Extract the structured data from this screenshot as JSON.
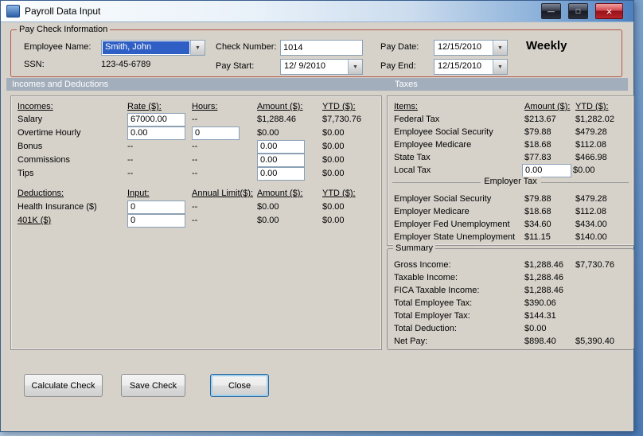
{
  "icons": {
    "minimize": "—",
    "maximize": "□",
    "close": "×",
    "dropdown": "▼"
  },
  "window": {
    "title": "Payroll Data Input"
  },
  "paycheck": {
    "group_label": "Pay Check Information",
    "employee_name_label": "Employee Name:",
    "employee_name_value": "Smith, John",
    "ssn_label": "SSN:",
    "ssn_value": "123-45-6789",
    "check_number_label": "Check Number:",
    "check_number_value": "1014",
    "pay_start_label": "Pay Start:",
    "pay_start_value": "12/ 9/2010",
    "pay_date_label": "Pay Date:",
    "pay_date_value": "12/15/2010",
    "pay_end_label": "Pay End:",
    "pay_end_value": "12/15/2010",
    "frequency": "Weekly"
  },
  "section_bar": {
    "left": "Incomes and Deductions",
    "right": "Taxes"
  },
  "incomes": {
    "headers": {
      "name": "Incomes:",
      "rate": "Rate ($):",
      "hours": "Hours:",
      "amount": "Amount ($):",
      "ytd": "YTD ($):"
    },
    "rows": [
      {
        "label": "Salary",
        "rate": "67000.00",
        "hours": "--",
        "amount": "$1,288.46",
        "ytd": "$7,730.76"
      },
      {
        "label": "Overtime Hourly",
        "rate": "0.00",
        "hours": "0",
        "amount": "$0.00",
        "ytd": "$0.00"
      },
      {
        "label": "Bonus",
        "rate": "--",
        "hours": "--",
        "amount": "0.00",
        "ytd": "$0.00"
      },
      {
        "label": "Commissions",
        "rate": "--",
        "hours": "--",
        "amount": "0.00",
        "ytd": "$0.00"
      },
      {
        "label": "Tips",
        "rate": "--",
        "hours": "--",
        "amount": "0.00",
        "ytd": "$0.00"
      }
    ]
  },
  "deductions": {
    "headers": {
      "name": "Deductions:",
      "input": "Input:",
      "annual_limit": "Annual Limit($):",
      "amount": "Amount ($):",
      "ytd": "YTD ($):"
    },
    "rows": [
      {
        "label": "Health Insurance ($)",
        "input": "0",
        "annual_limit": "--",
        "amount": "$0.00",
        "ytd": "$0.00"
      },
      {
        "label": "401K ($)",
        "input": "0",
        "annual_limit": "--",
        "amount": "$0.00",
        "ytd": "$0.00"
      }
    ]
  },
  "taxes": {
    "headers": {
      "items": "Items:",
      "amount": "Amount ($):",
      "ytd": "YTD ($):"
    },
    "employee_rows": [
      {
        "label": "Federal Tax",
        "amount": "$213.67",
        "ytd": "$1,282.02"
      },
      {
        "label": "Employee Social Security",
        "amount": "$79.88",
        "ytd": "$479.28"
      },
      {
        "label": "Employee Medicare",
        "amount": "$18.68",
        "ytd": "$112.08"
      },
      {
        "label": "State Tax",
        "amount": "$77.83",
        "ytd": "$466.98"
      },
      {
        "label": "Local Tax",
        "amount": "0.00",
        "ytd": "$0.00"
      }
    ],
    "employer_section_label": "Employer Tax",
    "employer_rows": [
      {
        "label": "Employer Social Security",
        "amount": "$79.88",
        "ytd": "$479.28"
      },
      {
        "label": "Employer Medicare",
        "amount": "$18.68",
        "ytd": "$112.08"
      },
      {
        "label": "Employer Fed Unemployment",
        "amount": "$34.60",
        "ytd": "$434.00"
      },
      {
        "label": "Employer State Unemployment",
        "amount": "$11.15",
        "ytd": "$140.00"
      }
    ]
  },
  "summary": {
    "group_label": "Summary",
    "rows": [
      {
        "label": "Gross Income:",
        "amount": "$1,288.46",
        "ytd": "$7,730.76"
      },
      {
        "label": "Taxable Income:",
        "amount": "$1,288.46",
        "ytd": ""
      },
      {
        "label": "FICA Taxable Income:",
        "amount": "$1,288.46",
        "ytd": ""
      },
      {
        "label": "Total Employee Tax:",
        "amount": "$390.06",
        "ytd": ""
      },
      {
        "label": "Total Employer Tax:",
        "amount": "$144.31",
        "ytd": ""
      },
      {
        "label": "Total Deduction:",
        "amount": "$0.00",
        "ytd": ""
      },
      {
        "label": "Net Pay:",
        "amount": "$898.40",
        "ytd": "$5,390.40"
      }
    ]
  },
  "buttons": {
    "calculate": "Calculate Check",
    "save": "Save Check",
    "close": "Close"
  }
}
